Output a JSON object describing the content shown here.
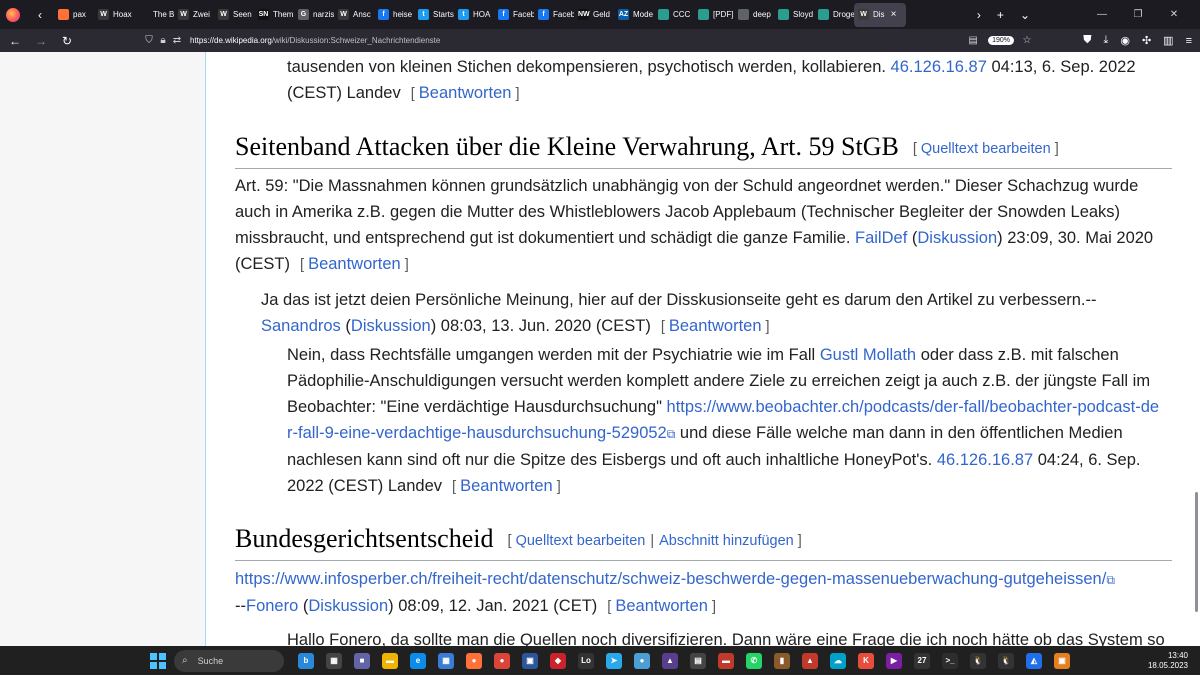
{
  "browser": {
    "tabs": [
      {
        "title": "pax",
        "color": "#ff7139",
        "glyph": ""
      },
      {
        "title": "Hoax",
        "color": "#3a3a3a",
        "glyph": "W"
      },
      {
        "title": "The Buffal",
        "color": "#1c1b22",
        "glyph": ""
      },
      {
        "title": "Zwei",
        "color": "#3a3a3a",
        "glyph": "W"
      },
      {
        "title": "Seen",
        "color": "#3a3a3a",
        "glyph": "W"
      },
      {
        "title": "Them",
        "color": "#111111",
        "glyph": "SN"
      },
      {
        "title": "narzis",
        "color": "#5f6368",
        "glyph": "G"
      },
      {
        "title": "Ansc",
        "color": "#3a3a3a",
        "glyph": "W"
      },
      {
        "title": "heise",
        "color": "#1877f2",
        "glyph": "f"
      },
      {
        "title": "Startse",
        "color": "#1d9bf0",
        "glyph": "t"
      },
      {
        "title": "HOA",
        "color": "#1d9bf0",
        "glyph": "t"
      },
      {
        "title": "Faceb",
        "color": "#1877f2",
        "glyph": "f"
      },
      {
        "title": "Faceb",
        "color": "#1877f2",
        "glyph": "f"
      },
      {
        "title": "Geld",
        "color": "#111111",
        "glyph": "NW"
      },
      {
        "title": "Mode",
        "color": "#0b5ea8",
        "glyph": "AZ"
      },
      {
        "title": "CCC",
        "color": "#2a9d8f",
        "glyph": ""
      },
      {
        "title": "[PDF]",
        "color": "#2a9d8f",
        "glyph": ""
      },
      {
        "title": "deep",
        "color": "#5f6368",
        "glyph": ""
      },
      {
        "title": "Sloyd",
        "color": "#2a9d8f",
        "glyph": ""
      },
      {
        "title": "Droge",
        "color": "#2a9d8f",
        "glyph": ""
      },
      {
        "title": "Dis",
        "color": "#3a3a3a",
        "glyph": "W",
        "active": true
      }
    ],
    "tab_close": "×",
    "new_tab": "+",
    "tab_list": "⌄",
    "win_min": "—",
    "win_max": "❐",
    "win_close": "✕",
    "nav_back": "←",
    "nav_forward": "→",
    "nav_reload": "↻",
    "url_host": "https://de.wikipedia.org",
    "url_path": "/wiki/Diskussion:Schweizer_Nachrichtendienste",
    "zoom": "190%"
  },
  "page": {
    "block1": {
      "line1_text": "tausenden von kleinen Stichen dekompensieren, psychotisch werden, kollabieren. ",
      "ip": "46.126.16.87",
      "time": " 04:13, 6. Sep. 2022",
      "line2_text": "(CEST) Landev",
      "reply": "Beantworten"
    },
    "section1": {
      "title": "Seitenband Attacken über die Kleine Verwahrung, Art. 59 StGB",
      "edit": "Quelltext bearbeiten"
    },
    "post1": {
      "l1": "Art. 59: \"Die Massnahmen können grundsätzlich unabhängig von der Schuld angeordnet werden.\" Dieser Schachzug wurde",
      "l2": "auch in Amerika z.B. gegen die Mutter des Whistleblowers Jacob Applebaum (Technischer Begleiter der Snowden Leaks)",
      "l3": "missbraucht, und entsprechend gut ist dokumentiert und schädigt die ganze Familie. ",
      "user": "FailDef",
      "talk": "Diskussion",
      "time": " 23:09, 30. Mai 2020",
      "l4": "(CEST)",
      "reply": "Beantworten"
    },
    "post2": {
      "l1": "Ja das ist jetzt deien Persönliche Meinung, hier auf der Disskusionseite geht es darum den Artikel zu verbessern.--",
      "user": "Sanandros",
      "talk": "Diskussion",
      "time": " 08:03, 13. Jun. 2020 (CEST)",
      "reply": "Beantworten"
    },
    "post3": {
      "l1": "Nein, dass Rechtsfälle umgangen werden mit der Psychiatrie wie im Fall ",
      "l1_link": "Gustl Mollath",
      "l1_end": " oder dass z.B. mit falschen",
      "l2": "Pädophilie-Anschuldigungen versucht werden komplett andere Ziele zu erreichen zeigt ja auch z.B. der jüngste Fall im",
      "l3": "Beobachter: \"Eine verdächtige Hausdurchsuchung\" ",
      "url1": "https://www.beobachter.ch/podcasts/der-fall/beobachter-podcast-de",
      "url2": "r-fall-9-eine-verdachtige-hausdurchsuchung-529052",
      "l4_end": " und diese Fälle welche man dann in den öffentlichen Medien",
      "l5": "nachlesen kann sind oft nur die Spitze des Eisbergs und oft auch inhaltliche HoneyPot's. ",
      "ip": "46.126.16.87",
      "time": " 04:24, 6. Sep.",
      "l6": "2022 (CEST) Landev",
      "reply": "Beantworten"
    },
    "section2": {
      "title": "Bundesgerichtsentscheid",
      "edit": "Quelltext bearbeiten",
      "sep": "|",
      "add": "Abschnitt hinzufügen"
    },
    "post4": {
      "url": "https://www.infosperber.ch/freiheit-recht/datenschutz/schweiz-beschwerde-gegen-massenueberwachung-gutgeheissen/",
      "dash": "--",
      "user": "Fonero",
      "talk": "Diskussion",
      "time": " 08:09, 12. Jan. 2021 (CET)",
      "reply": "Beantworten"
    },
    "post5": {
      "l1": "Hallo Fonero, da sollte man die Quellen noch diversifizieren. Dann wäre eine Frage die ich noch hätte ob das System so"
    }
  },
  "taskbar": {
    "search_label": "Suche",
    "apps": [
      {
        "color": "#2b88d8",
        "glyph": "b"
      },
      {
        "color": "#444444",
        "glyph": "▦"
      },
      {
        "color": "#6264a7",
        "glyph": "■"
      },
      {
        "color": "#f0b400",
        "glyph": "▬"
      },
      {
        "color": "#0c8ce9",
        "glyph": "e"
      },
      {
        "color": "#3a7bd5",
        "glyph": "▦"
      },
      {
        "color": "#ff7139",
        "glyph": "●"
      },
      {
        "color": "#db4437",
        "glyph": "●"
      },
      {
        "color": "#2b579a",
        "glyph": "▣"
      },
      {
        "color": "#cc2229",
        "glyph": "◆"
      },
      {
        "color": "#333333",
        "glyph": "Lo"
      },
      {
        "color": "#29a9eb",
        "glyph": "➤"
      },
      {
        "color": "#4b9fd5",
        "glyph": "●"
      },
      {
        "color": "#5a3e8e",
        "glyph": "▲"
      },
      {
        "color": "#444444",
        "glyph": "▤"
      },
      {
        "color": "#c0392b",
        "glyph": "▬"
      },
      {
        "color": "#25d366",
        "glyph": "✆"
      },
      {
        "color": "#8b5a2b",
        "glyph": "▮"
      },
      {
        "color": "#c0392b",
        "glyph": "▲"
      },
      {
        "color": "#00a1c9",
        "glyph": "☁"
      },
      {
        "color": "#e74c3c",
        "glyph": "K"
      },
      {
        "color": "#7b1fa2",
        "glyph": "▶"
      },
      {
        "color": "#333333",
        "glyph": "27"
      },
      {
        "color": "#2d2d2d",
        "glyph": ">_"
      },
      {
        "color": "#333333",
        "glyph": "🐧"
      },
      {
        "color": "#333333",
        "glyph": "🐧"
      },
      {
        "color": "#1f6feb",
        "glyph": "◭"
      },
      {
        "color": "#e67e22",
        "glyph": "▣"
      }
    ],
    "time": "13:40",
    "date": "18.05.2023"
  }
}
